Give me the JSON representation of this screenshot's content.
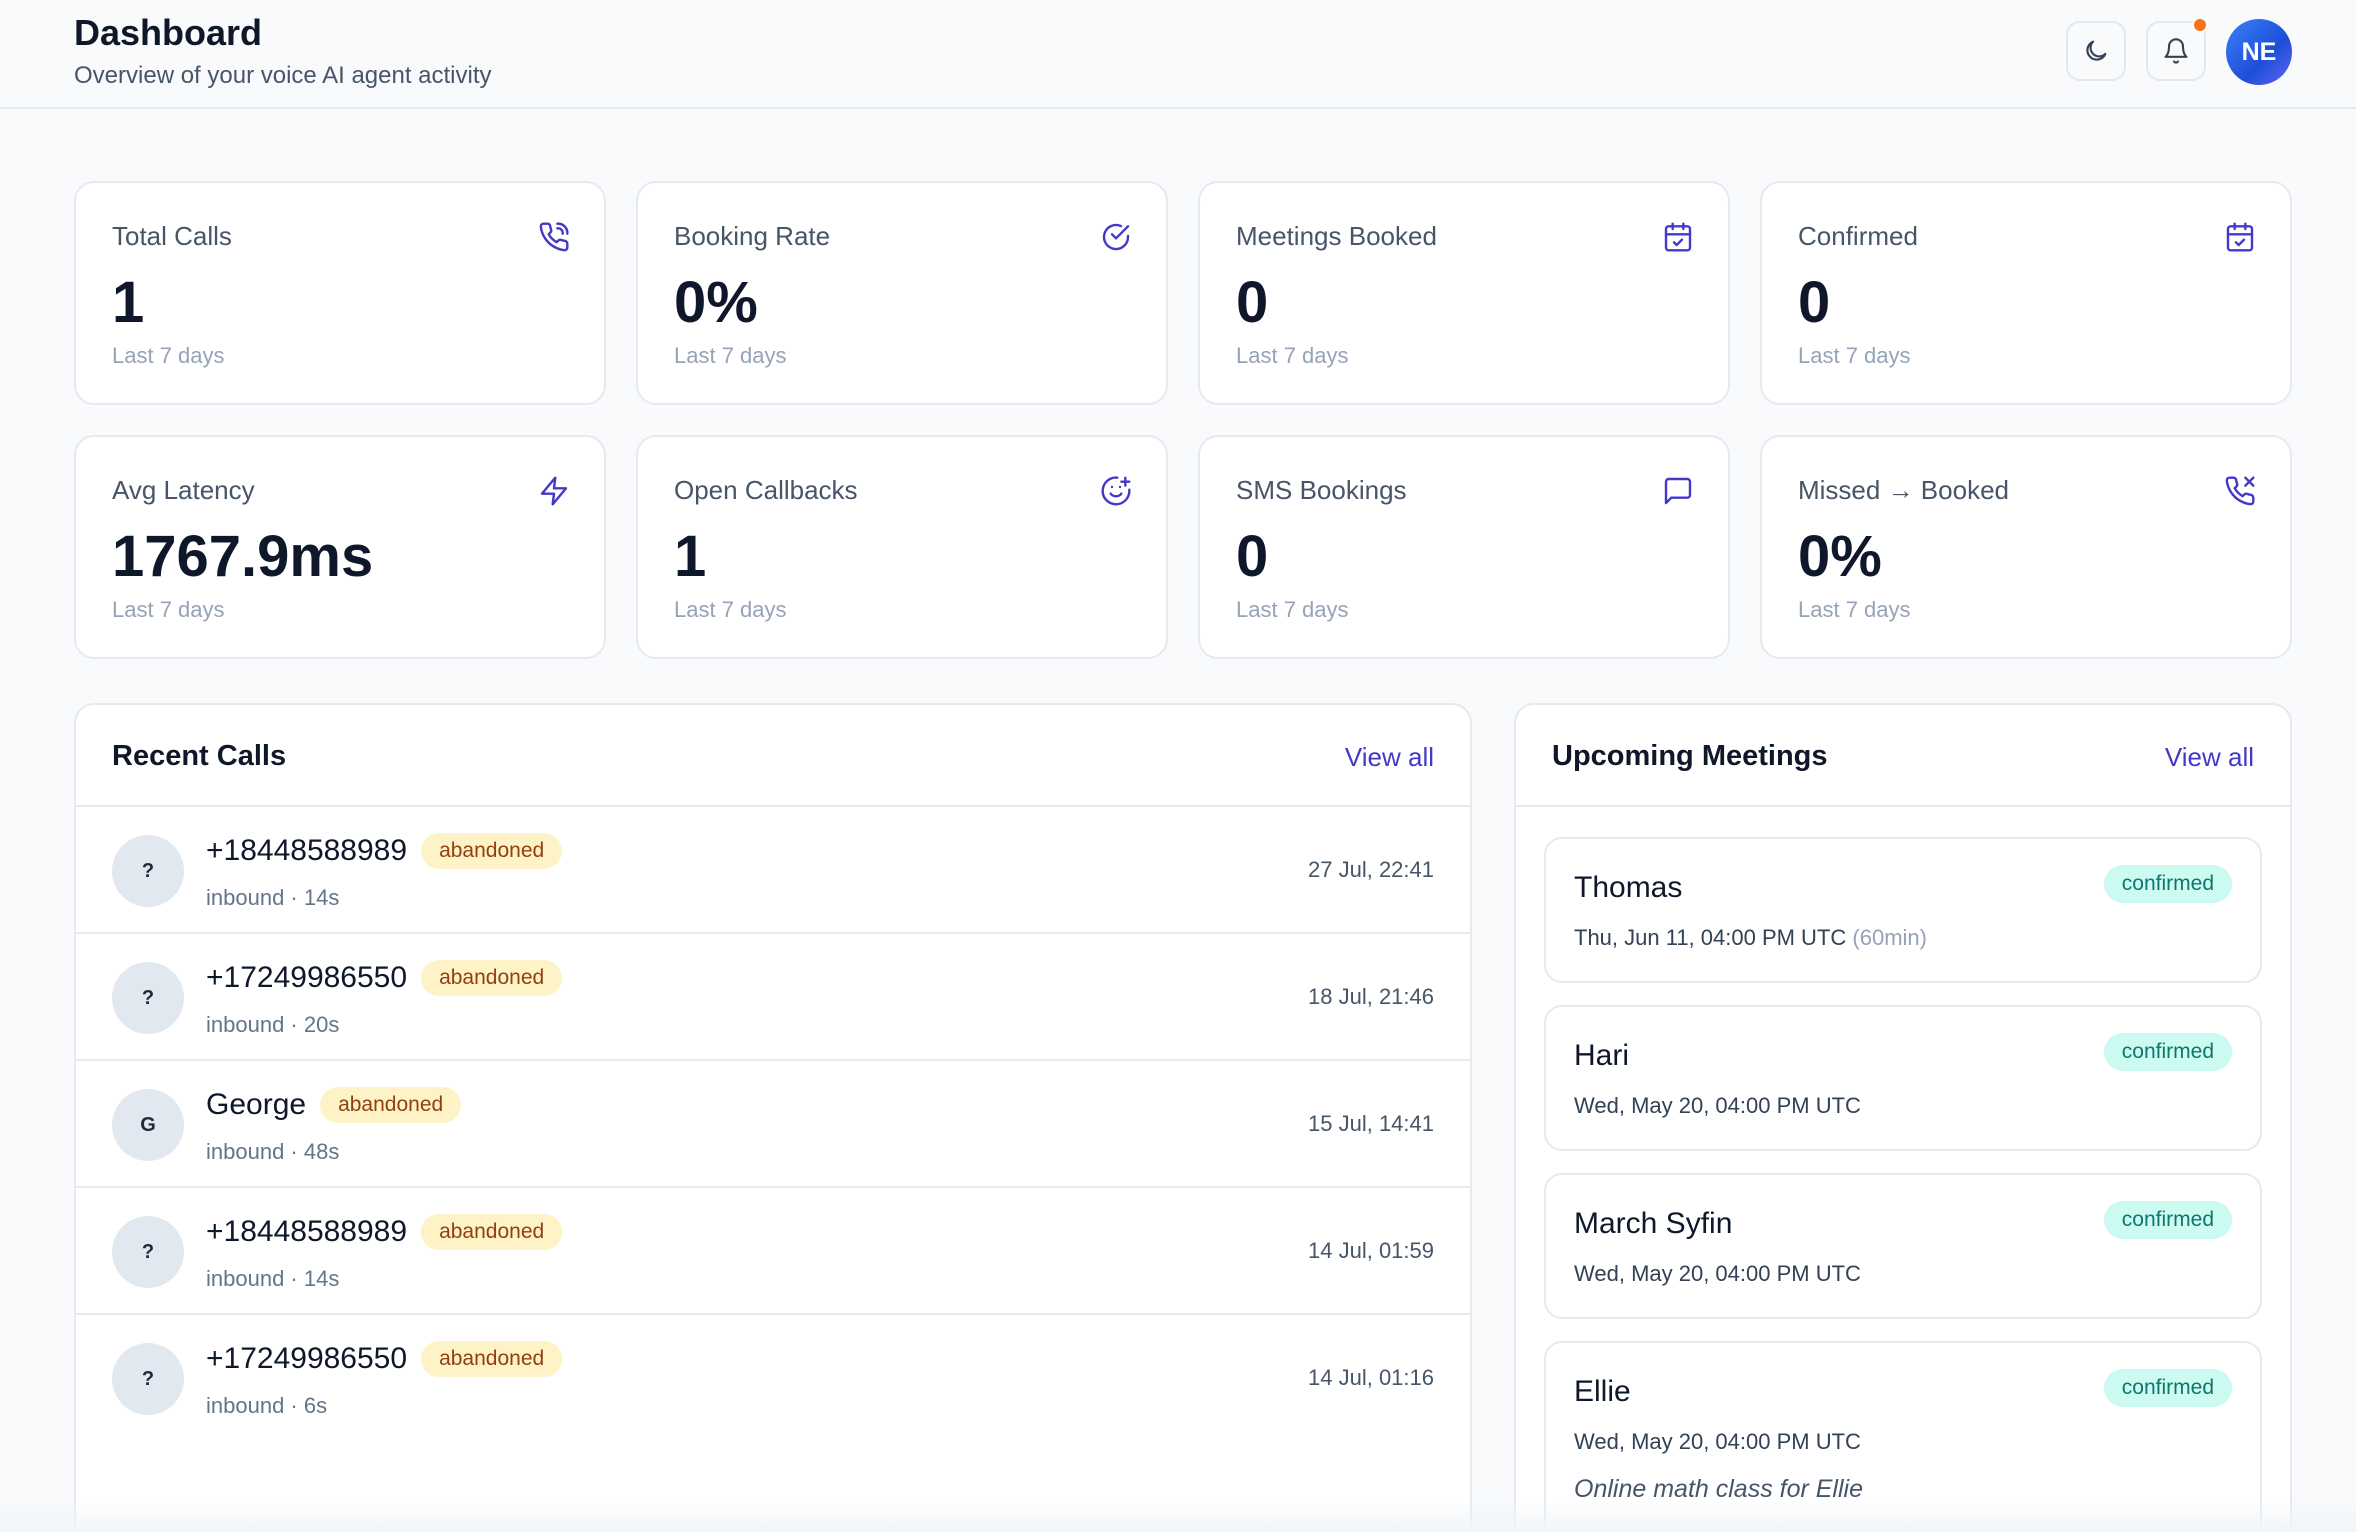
{
  "header": {
    "title": "Dashboard",
    "subtitle": "Overview of your voice AI agent activity",
    "theme_icon": "moon-icon",
    "notification_icon": "bell-icon",
    "avatar_initials": "NE"
  },
  "stats": [
    {
      "label": "Total Calls",
      "value": "1",
      "sub": "Last 7 days",
      "icon": "phone-incoming-icon"
    },
    {
      "label": "Booking Rate",
      "value": "0%",
      "sub": "Last 7 days",
      "icon": "check-circle-icon"
    },
    {
      "label": "Meetings Booked",
      "value": "0",
      "sub": "Last 7 days",
      "icon": "calendar-check-icon"
    },
    {
      "label": "Confirmed",
      "value": "0",
      "sub": "Last 7 days",
      "icon": "calendar-check-icon"
    },
    {
      "label": "Avg Latency",
      "value": "1767.9ms",
      "sub": "Last 7 days",
      "icon": "lightning-icon"
    },
    {
      "label": "Open Callbacks",
      "value": "1",
      "sub": "Last 7 days",
      "icon": "smile-plus-icon"
    },
    {
      "label": "SMS Bookings",
      "value": "0",
      "sub": "Last 7 days",
      "icon": "message-square-icon"
    },
    {
      "label": "Missed → Booked",
      "value": "0%",
      "sub": "Last 7 days",
      "icon": "phone-missed-icon"
    }
  ],
  "recent_calls": {
    "title": "Recent Calls",
    "view_all": "View all",
    "items": [
      {
        "initial": "?",
        "name": "+18448588989",
        "status": "abandoned",
        "meta": "inbound · 14s",
        "time": "27 Jul, 22:41"
      },
      {
        "initial": "?",
        "name": "+17249986550",
        "status": "abandoned",
        "meta": "inbound · 20s",
        "time": "18 Jul, 21:46"
      },
      {
        "initial": "G",
        "name": "George",
        "status": "abandoned",
        "meta": "inbound · 48s",
        "time": "15 Jul, 14:41"
      },
      {
        "initial": "?",
        "name": "+18448588989",
        "status": "abandoned",
        "meta": "inbound · 14s",
        "time": "14 Jul, 01:59"
      },
      {
        "initial": "?",
        "name": "+17249986550",
        "status": "abandoned",
        "meta": "inbound · 6s",
        "time": "14 Jul, 01:16"
      }
    ]
  },
  "upcoming_meetings": {
    "title": "Upcoming Meetings",
    "view_all": "View all",
    "items": [
      {
        "name": "Thomas",
        "status": "confirmed",
        "time": "Thu, Jun 11, 04:00 PM UTC",
        "duration": "(60min)",
        "note": ""
      },
      {
        "name": "Hari",
        "status": "confirmed",
        "time": "Wed, May 20, 04:00 PM UTC",
        "duration": "",
        "note": ""
      },
      {
        "name": "March Syfin",
        "status": "confirmed",
        "time": "Wed, May 20, 04:00 PM UTC",
        "duration": "",
        "note": ""
      },
      {
        "name": "Ellie",
        "status": "confirmed",
        "time": "Wed, May 20, 04:00 PM UTC",
        "duration": "",
        "note": "Online math class for Ellie"
      }
    ]
  },
  "colors": {
    "accent": "#4338ca",
    "abandoned_bg": "#fef3c7",
    "abandoned_text": "#92400e",
    "confirmed_bg": "#ccfbf1",
    "confirmed_text": "#0f766e",
    "notification_dot": "#f97316"
  }
}
